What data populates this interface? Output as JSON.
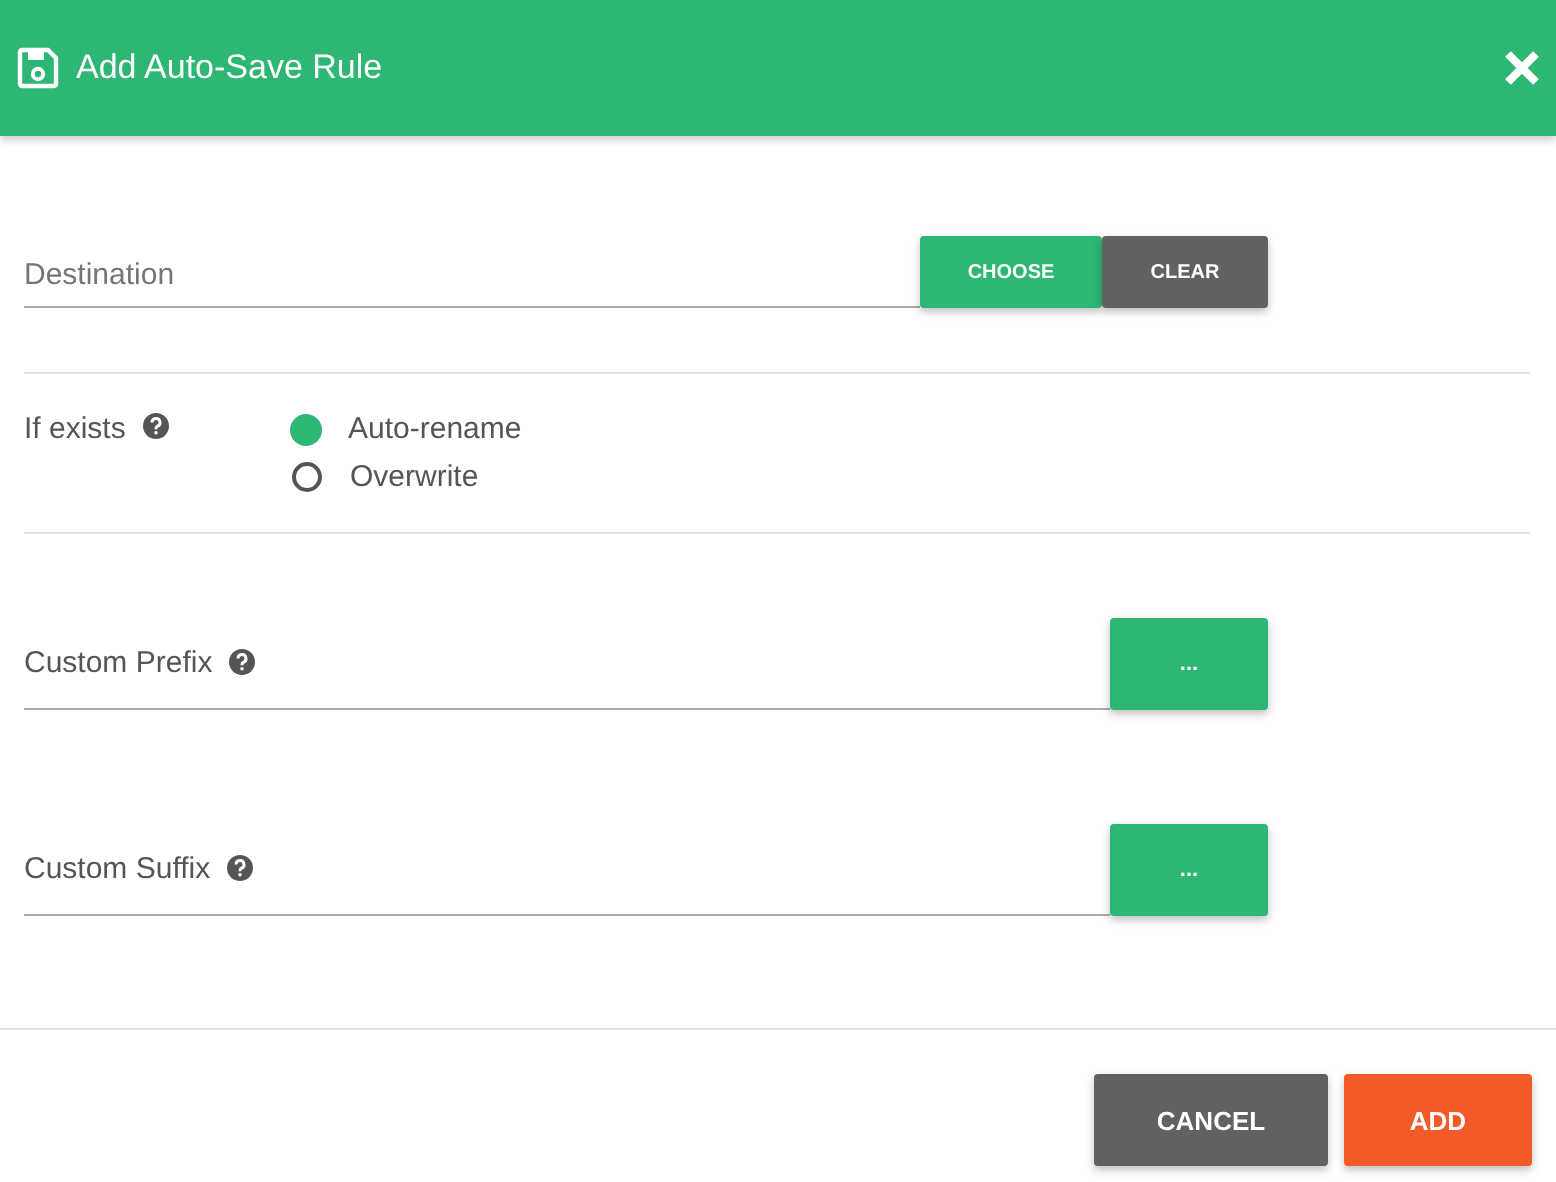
{
  "dialog": {
    "title": "Add Auto-Save Rule"
  },
  "destination": {
    "placeholder": "Destination",
    "buttons": [
      {
        "label": "CHOOSE",
        "kind": "primary"
      },
      {
        "label": "CLEAR",
        "kind": "secondary"
      }
    ]
  },
  "if_exists": {
    "label": "If exists",
    "options": [
      {
        "label": "Auto-rename",
        "selected": true
      },
      {
        "label": "Overwrite",
        "selected": false
      }
    ]
  },
  "fields": [
    {
      "label": "Custom Prefix",
      "button": "..."
    },
    {
      "label": "Custom Suffix",
      "button": "..."
    }
  ],
  "footer_buttons": [
    {
      "label": "CANCEL",
      "kind": "secondary"
    },
    {
      "label": "ADD",
      "kind": "accent"
    }
  ]
}
